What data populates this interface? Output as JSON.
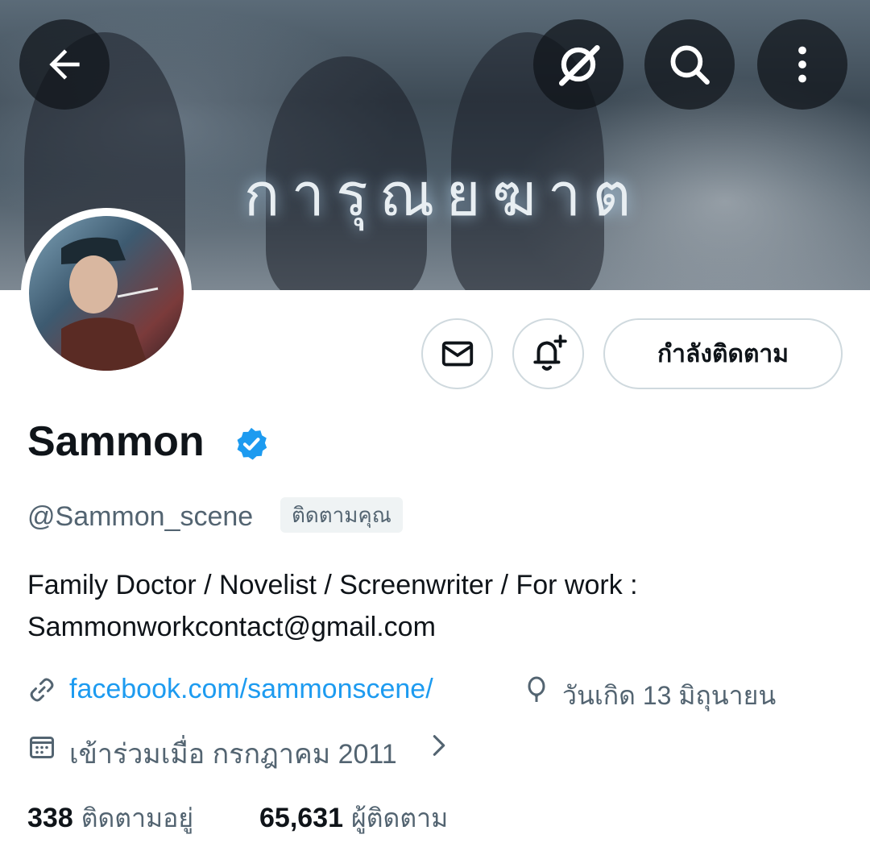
{
  "header": {
    "banner_title": "การุณยฆาต",
    "icons": {
      "back": "back-arrow-icon",
      "grok": "grok-icon",
      "search": "search-icon",
      "more": "more-vertical-icon"
    }
  },
  "actions": {
    "message_icon": "envelope-icon",
    "notify_icon": "bell-plus-icon",
    "following_label": "กำลังติดตาม"
  },
  "profile": {
    "name": "Sammon",
    "verified": true,
    "handle": "@Sammon_scene",
    "follows_you": "ติดตามคุณ",
    "bio_line1": "Family Doctor / Novelist / Screenwriter / For work :",
    "bio_line2": "Sammonworkcontact@gmail.com",
    "link": "facebook.com/sammonscene/",
    "birthday": "วันเกิด 13 มิถุนายน",
    "joined": "เข้าร่วมเมื่อ กรกฎาคม 2011"
  },
  "stats": {
    "following_count": "338",
    "following_label": "ติดตามอยู่",
    "followers_count": "65,631",
    "followers_label": "ผู้ติดตาม"
  },
  "colors": {
    "link": "#1d9bf0",
    "verified": "#1d9bf0",
    "secondary_text": "#536471"
  }
}
